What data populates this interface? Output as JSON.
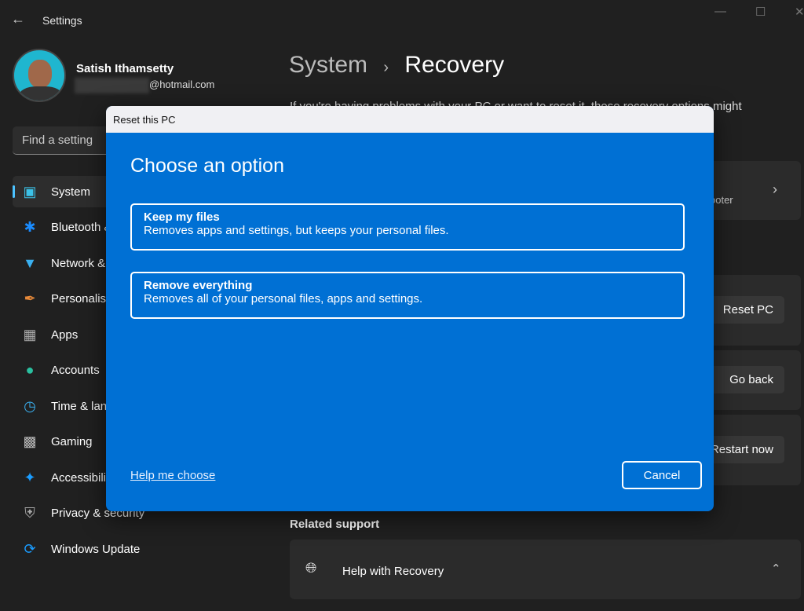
{
  "window": {
    "title": "Settings",
    "back_icon": "arrow-left-icon"
  },
  "user": {
    "name": "Satish Ithamsetty",
    "email_suffix": "@hotmail.com"
  },
  "search": {
    "placeholder": "Find a setting"
  },
  "sidebar": {
    "items": [
      {
        "label": "System",
        "icon": "monitor-icon",
        "selected": true
      },
      {
        "label": "Bluetooth & devices",
        "icon": "bluetooth-icon"
      },
      {
        "label": "Network & internet",
        "icon": "wifi-icon"
      },
      {
        "label": "Personalisation",
        "icon": "brush-icon"
      },
      {
        "label": "Apps",
        "icon": "apps-icon"
      },
      {
        "label": "Accounts",
        "icon": "person-icon"
      },
      {
        "label": "Time & language",
        "icon": "globe-clock-icon"
      },
      {
        "label": "Gaming",
        "icon": "gamepad-icon"
      },
      {
        "label": "Accessibility",
        "icon": "accessibility-icon"
      },
      {
        "label": "Privacy & security",
        "icon": "shield-icon"
      },
      {
        "label": "Windows Update",
        "icon": "update-icon"
      }
    ]
  },
  "main": {
    "breadcrumb_parent": "System",
    "breadcrumb_current": "Recovery",
    "intro": "If you're having problems with your PC or want to reset it, these recovery options might",
    "troubleshooter_fragment": "ooter",
    "buttons": {
      "reset": "Reset PC",
      "go_back": "Go back",
      "restart": "Restart now"
    },
    "related_support": "Related support",
    "help_recovery": "Help with Recovery"
  },
  "dialog": {
    "title": "Reset this PC",
    "heading": "Choose an option",
    "options": [
      {
        "title": "Keep my files",
        "desc": "Removes apps and settings, but keeps your personal files."
      },
      {
        "title": "Remove everything",
        "desc": "Removes all of your personal files, apps and settings."
      }
    ],
    "help_link": "Help me choose",
    "cancel": "Cancel",
    "color": "#0070d4"
  }
}
